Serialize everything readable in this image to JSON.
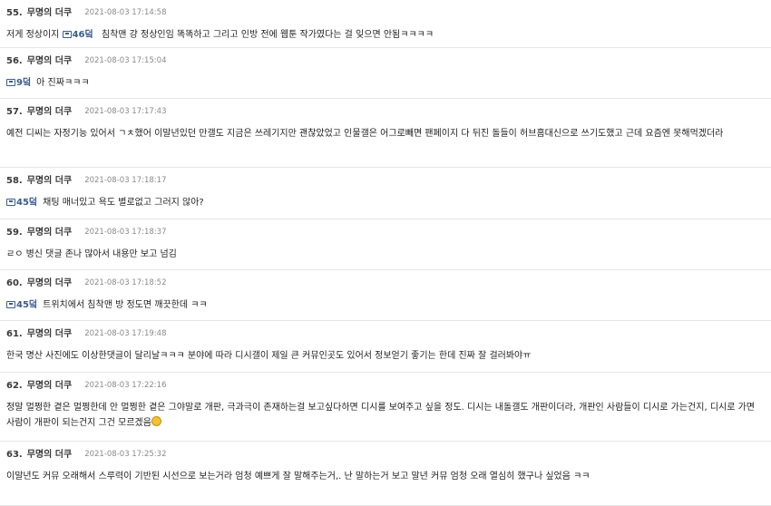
{
  "posts": [
    {
      "num": "55.",
      "author": "무명의 더쿠",
      "date": "2021-08-03 17:14:58",
      "anchor": null,
      "text": "저게 정상이지 ",
      "anchor_inline": "46덬",
      "text_after": " 침착맨 걍 정상인임 똑똑하고 그리고 인방 전에 웹툰 작가였다는 걸 잊으면 안됨ㅋㅋㅋㅋ",
      "emoji": false
    },
    {
      "num": "56.",
      "author": "무명의 더쿠",
      "date": "2021-08-03 17:15:04",
      "anchor": "9덬",
      "text": "아 진짜ㅋㅋㅋ",
      "emoji": false
    },
    {
      "num": "57.",
      "author": "무명의 더쿠",
      "date": "2021-08-03 17:17:43",
      "anchor": null,
      "text": "예전 디씨는 자정기능 있어서 ㄱㅊ했어 이말년있던 만갤도 지금은 쓰레기지만 괜찮았었고 인물갤은 어그로빼면 팬페이지 다 뒤진 돌들이 허브홈대신으로 쓰기도했고 근데 요즘엔 못해먹겠더라",
      "emoji": false
    },
    {
      "num": "58.",
      "author": "무명의 더쿠",
      "date": "2021-08-03 17:18:17",
      "anchor": "45덬",
      "text": "채팅 매너있고 욕도 별로없고 그러지 않아?",
      "emoji": false
    },
    {
      "num": "59.",
      "author": "무명의 더쿠",
      "date": "2021-08-03 17:18:37",
      "anchor": null,
      "text": "ㄹㅇ 병신 댓글 존나 많아서 내용만 보고 넘김",
      "emoji": false
    },
    {
      "num": "60.",
      "author": "무명의 더쿠",
      "date": "2021-08-03 17:18:52",
      "anchor": "45덬",
      "text": "트위치에서 침착맨 방 정도면 깨끗한데 ㅋㅋ",
      "emoji": false
    },
    {
      "num": "61.",
      "author": "무명의 더쿠",
      "date": "2021-08-03 17:19:48",
      "anchor": null,
      "text": "한국 명산 사진에도 이상한댓글이 달리날ㅋㅋㅋ 분야에 따라 디시갤이 제일 큰 커뮤인곳도 있어서 정보얻기 좋기는 한데 진짜 잘 걸러봐야ㅠ",
      "emoji": false
    },
    {
      "num": "62.",
      "author": "무명의 더쿠",
      "date": "2021-08-03 17:22:16",
      "anchor": null,
      "text": "정말 멀쩡한 곁은 멀쩡한데 안 멀쩡한 곁은 그야말로 개판, 극과극이 존재하는걸 보고싶다하면 디시를 보여주고 싶을 정도. 디시는 내돌갤도 개판이더라, 개판인 사람들이 디시로 가는건지, 디시로 가면 사람이 개판이 되는건지 그건 모르겠음",
      "emoji": true
    },
    {
      "num": "63.",
      "author": "무명의 더쿠",
      "date": "2021-08-03 17:25:32",
      "anchor": null,
      "text": "이말년도 커뮤 오래해서 스루력이 기반된 시선으로 보는거라 엄청 예쁘게 잘 말해주는거,. 난 말하는거 보고 말년 커뮤 엄청 오래 열심히 했구나 싶었음 ㅋㅋ",
      "emoji": false
    }
  ]
}
